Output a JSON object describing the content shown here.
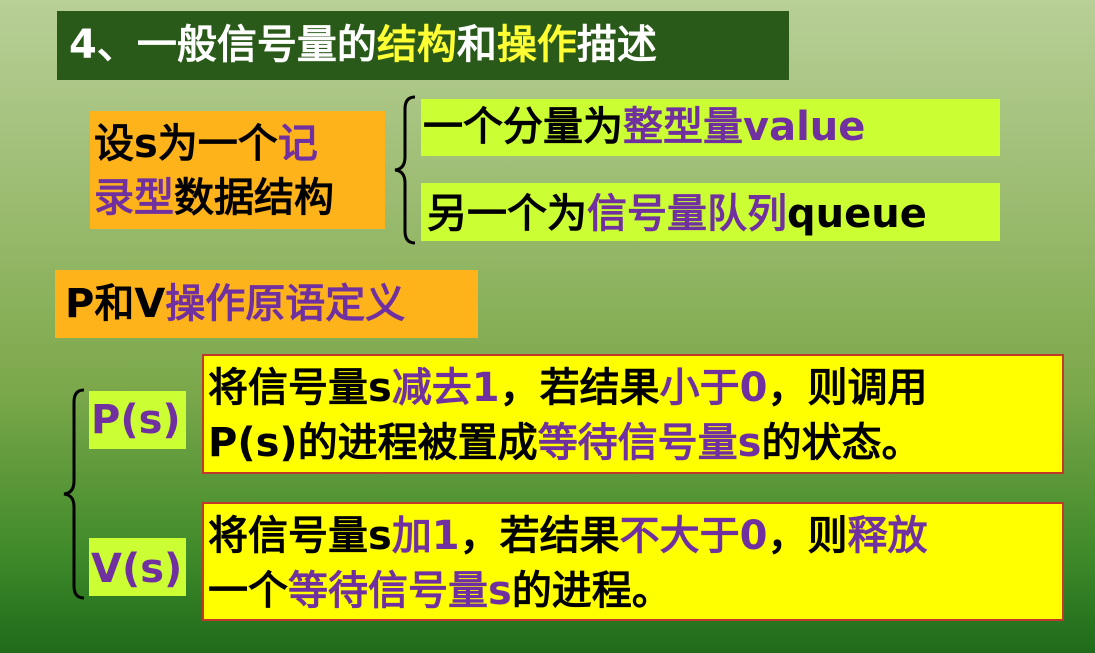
{
  "title": {
    "prefix": "4、一般信号量的",
    "structure": "结构",
    "and": "和",
    "operation": "操作",
    "suffix": "描述"
  },
  "record": {
    "line1_a": "设s为一个",
    "line1_b": "记",
    "line2_a": "录型",
    "line2_b": "数据结构"
  },
  "component1": {
    "prefix": "一个分量为",
    "name": "整型量",
    "id": "value"
  },
  "component2": {
    "prefix": "另一个为",
    "name": "信号量队列",
    "id": "queue"
  },
  "pv_heading": {
    "prefix": "P和V",
    "name": "操作原语定义"
  },
  "p_op": {
    "label": "P(s)",
    "l1_a": "将信号量s",
    "l1_b": "减去1",
    "l1_c": "，若结果",
    "l1_d": "小于0",
    "l1_e": "，则调用",
    "l2_a": "P(s)的进程被置成",
    "l2_b": "等待信号量s",
    "l2_c": "的状态。"
  },
  "v_op": {
    "label": "V(s)",
    "l1_a": "将信号量s",
    "l1_b": "加1",
    "l1_c": "，若结果",
    "l1_d": "不大于0",
    "l1_e": "，则",
    "l1_f": "释放",
    "l2_a": "一个",
    "l2_b": "等待信号量s",
    "l2_c": "的进程。"
  },
  "colors": {
    "title_bg": "#2a5a19",
    "highlight_yellow": "#ffff33",
    "orange_box": "#ffb31a",
    "lime_box": "#ccff33",
    "yellow_box": "#ffff00",
    "purple_text": "#7030a0",
    "box_border": "#c0392b"
  }
}
